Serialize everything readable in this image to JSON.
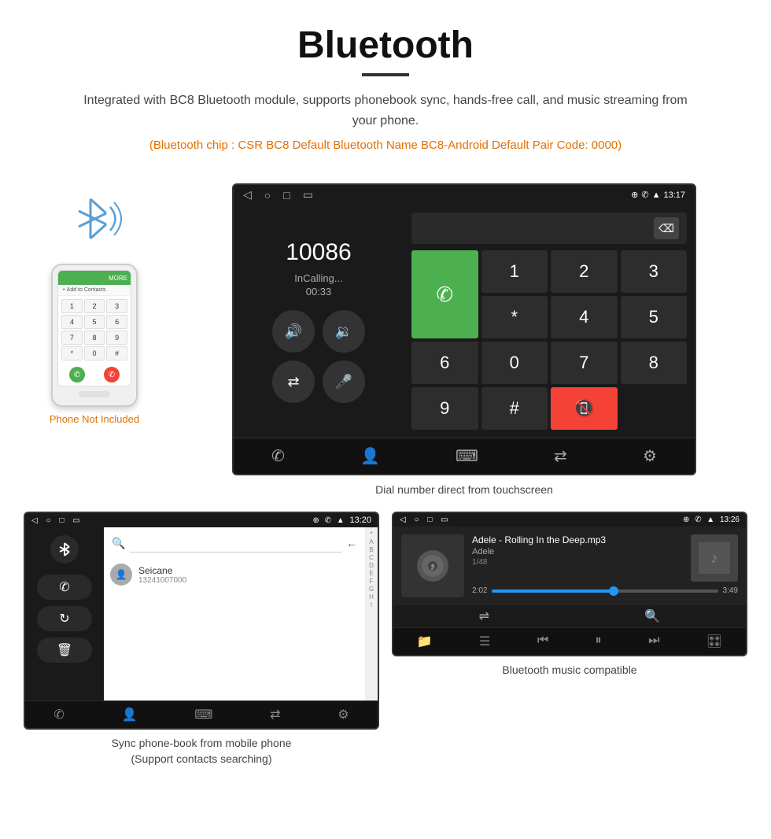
{
  "header": {
    "title": "Bluetooth",
    "description": "Integrated with BC8 Bluetooth module, supports phonebook sync, hands-free call, and music streaming from your phone.",
    "bluetooth_info": "(Bluetooth chip : CSR BC8    Default Bluetooth Name BC8-Android    Default Pair Code: 0000)"
  },
  "phone_illustration": {
    "not_included": "Phone Not Included",
    "keys": [
      "1",
      "2",
      "3",
      "4",
      "5",
      "6",
      "7",
      "8",
      "9",
      "*",
      "0",
      "#"
    ]
  },
  "dial_screen": {
    "status_time": "13:17",
    "dialed_number": "10086",
    "calling_label": "InCalling...",
    "call_timer": "00:33",
    "caption": "Dial number direct from touchscreen",
    "keys": [
      "1",
      "2",
      "3",
      "4",
      "5",
      "6",
      "7",
      "8",
      "9",
      "#"
    ]
  },
  "phonebook_screen": {
    "status_time": "13:20",
    "contact_name": "Seicane",
    "contact_phone": "13241007000",
    "alpha_letters": [
      "*",
      "A",
      "B",
      "C",
      "D",
      "E",
      "F",
      "G",
      "H",
      "I"
    ],
    "caption": "Sync phone-book from mobile phone\n(Support contacts searching)"
  },
  "music_screen": {
    "status_time": "13:26",
    "track_name": "Adele - Rolling In the Deep.mp3",
    "artist": "Adele",
    "track_count": "1/48",
    "current_time": "2:02",
    "total_time": "3:49",
    "progress_percent": 54,
    "caption": "Bluetooth music compatible"
  },
  "icons": {
    "bluetooth": "⚡",
    "phone": "📞",
    "contacts": "👤",
    "keypad": "⌨",
    "settings": "⚙",
    "volume_up": "🔊",
    "volume_down": "🔉",
    "mute": "🔇",
    "mic": "🎤",
    "transfer": "⇄",
    "back_nav": "◁",
    "home_nav": "○",
    "recents_nav": "□",
    "music_note": "♪",
    "shuffle": "⇌",
    "prev": "⏮",
    "play": "⏸",
    "next": "⏭",
    "eq": "≡",
    "search": "🔍",
    "delete": "⌫",
    "folder": "📁",
    "list": "☰",
    "dial_transfer": "↗"
  }
}
